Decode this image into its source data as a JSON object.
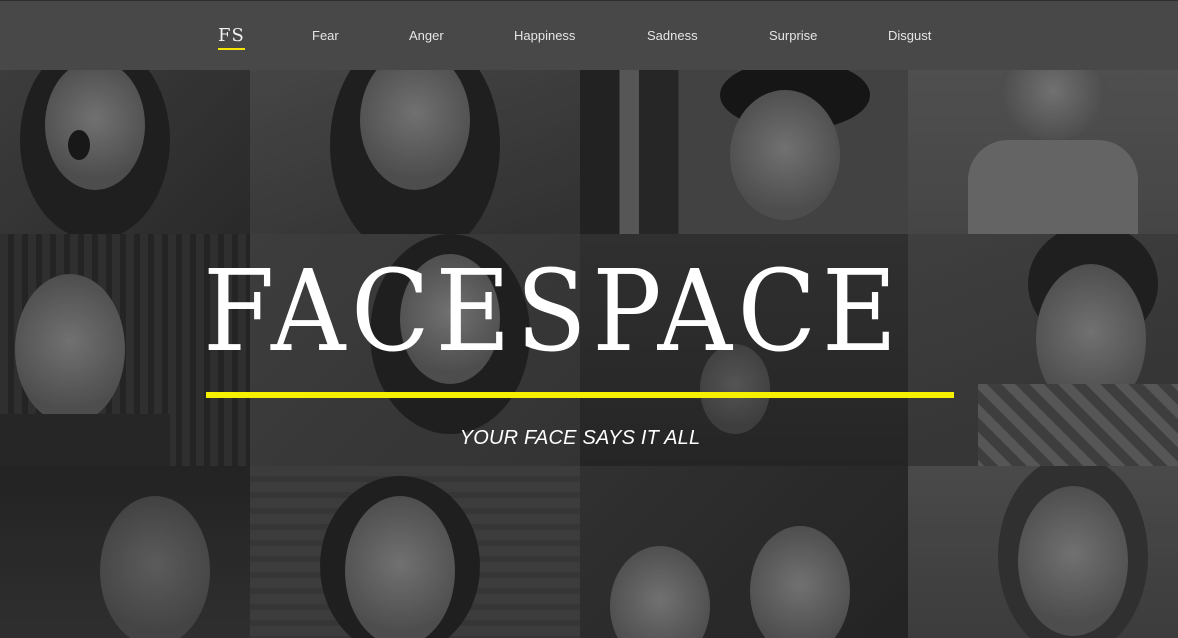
{
  "nav": {
    "brand": "FS",
    "items": [
      "Fear",
      "Anger",
      "Happiness",
      "Sadness",
      "Surprise",
      "Disgust"
    ]
  },
  "hero": {
    "title": "FACESPACE",
    "tagline": "YOUR FACE SAYS IT ALL"
  },
  "colors": {
    "accent": "#f5f000",
    "navbar": "#484848",
    "text": "#ffffff"
  }
}
